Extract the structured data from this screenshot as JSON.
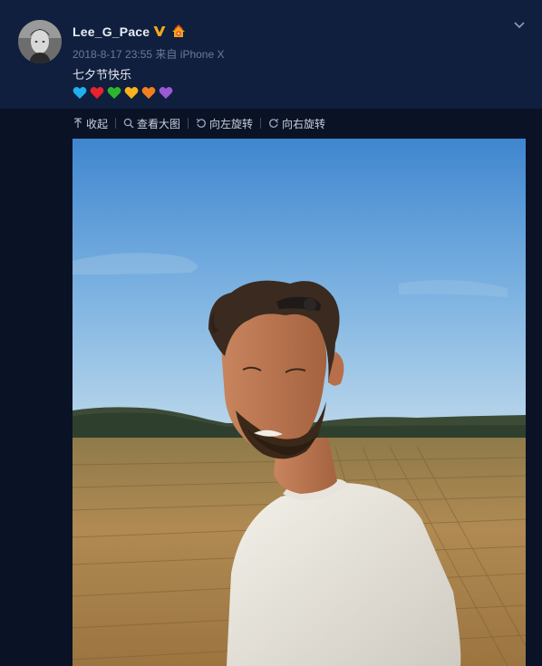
{
  "post": {
    "username": "Lee_G_Pace",
    "date": "2018-8-17 23:55",
    "source_prefix": "来自",
    "source": "iPhone X",
    "text": "七夕节快乐",
    "heart_colors": [
      "#1fb0f0",
      "#e8232b",
      "#2db62d",
      "#f7b21d",
      "#f37e1f",
      "#9b59d6"
    ]
  },
  "toolbar": {
    "collapse_label": "收起",
    "view_large_label": "查看大图",
    "rotate_left_label": "向左旋转",
    "rotate_right_label": "向右旋转"
  },
  "icons": {
    "verified": "verified-v-icon",
    "member": "member-badge-icon",
    "expand": "chevron-down-icon",
    "collapse": "arrow-up-icon",
    "zoom": "magnifier-icon",
    "rotate_left": "rotate-left-icon",
    "rotate_right": "rotate-right-icon"
  },
  "colors": {
    "background": "#0a1226",
    "card": "#0f1f3d",
    "accent": "#f4a61c"
  }
}
